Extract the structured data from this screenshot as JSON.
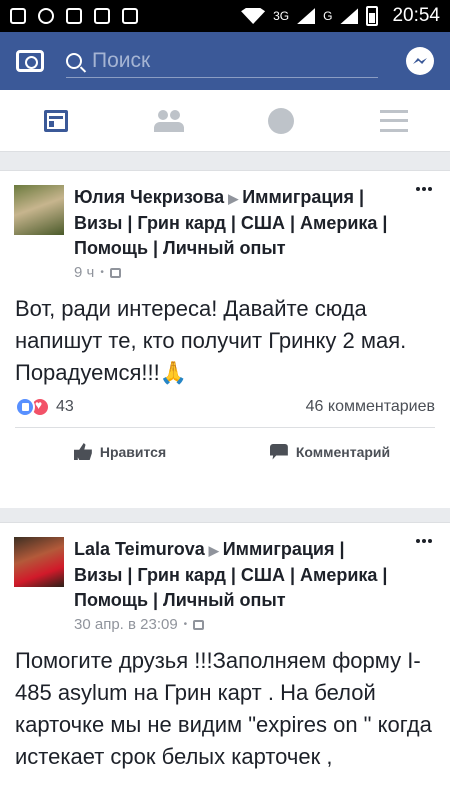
{
  "statusbar": {
    "network1": "3G",
    "network2": "G",
    "time": "20:54"
  },
  "topbar": {
    "search_placeholder": "Поиск"
  },
  "tabs": [
    {
      "name": "news-feed",
      "icon": "news-feed-icon",
      "active": true
    },
    {
      "name": "friends",
      "icon": "friends-icon",
      "active": false
    },
    {
      "name": "notifications",
      "icon": "globe-icon",
      "active": false
    },
    {
      "name": "menu",
      "icon": "menu-icon",
      "active": false
    }
  ],
  "posts": [
    {
      "author": "Юлия Чекризова",
      "group": "Иммиграция | Визы | Грин кард | США | Америка | Помощь | Личный опыт",
      "time": "9 ч",
      "text": "Вот, ради интереса! Давайте сюда напишут те, кто получит Гринку 2 мая. Порадуемся!!!🙏",
      "reactions": "43",
      "comments": "46 комментариев",
      "like_label": "Нравится",
      "comment_label": "Комментарий"
    },
    {
      "author": "Lala Teimurova",
      "group": "Иммиграция | Визы | Грин кард | США | Америка | Помощь | Личный опыт",
      "time": "30 апр. в 23:09",
      "text": "Помогите друзья !!!Заполняем форму I-485 asylum на Грин карт . На белой карточке мы не видим \"expires on \" когда истекает срок белых карточек ,"
    }
  ]
}
